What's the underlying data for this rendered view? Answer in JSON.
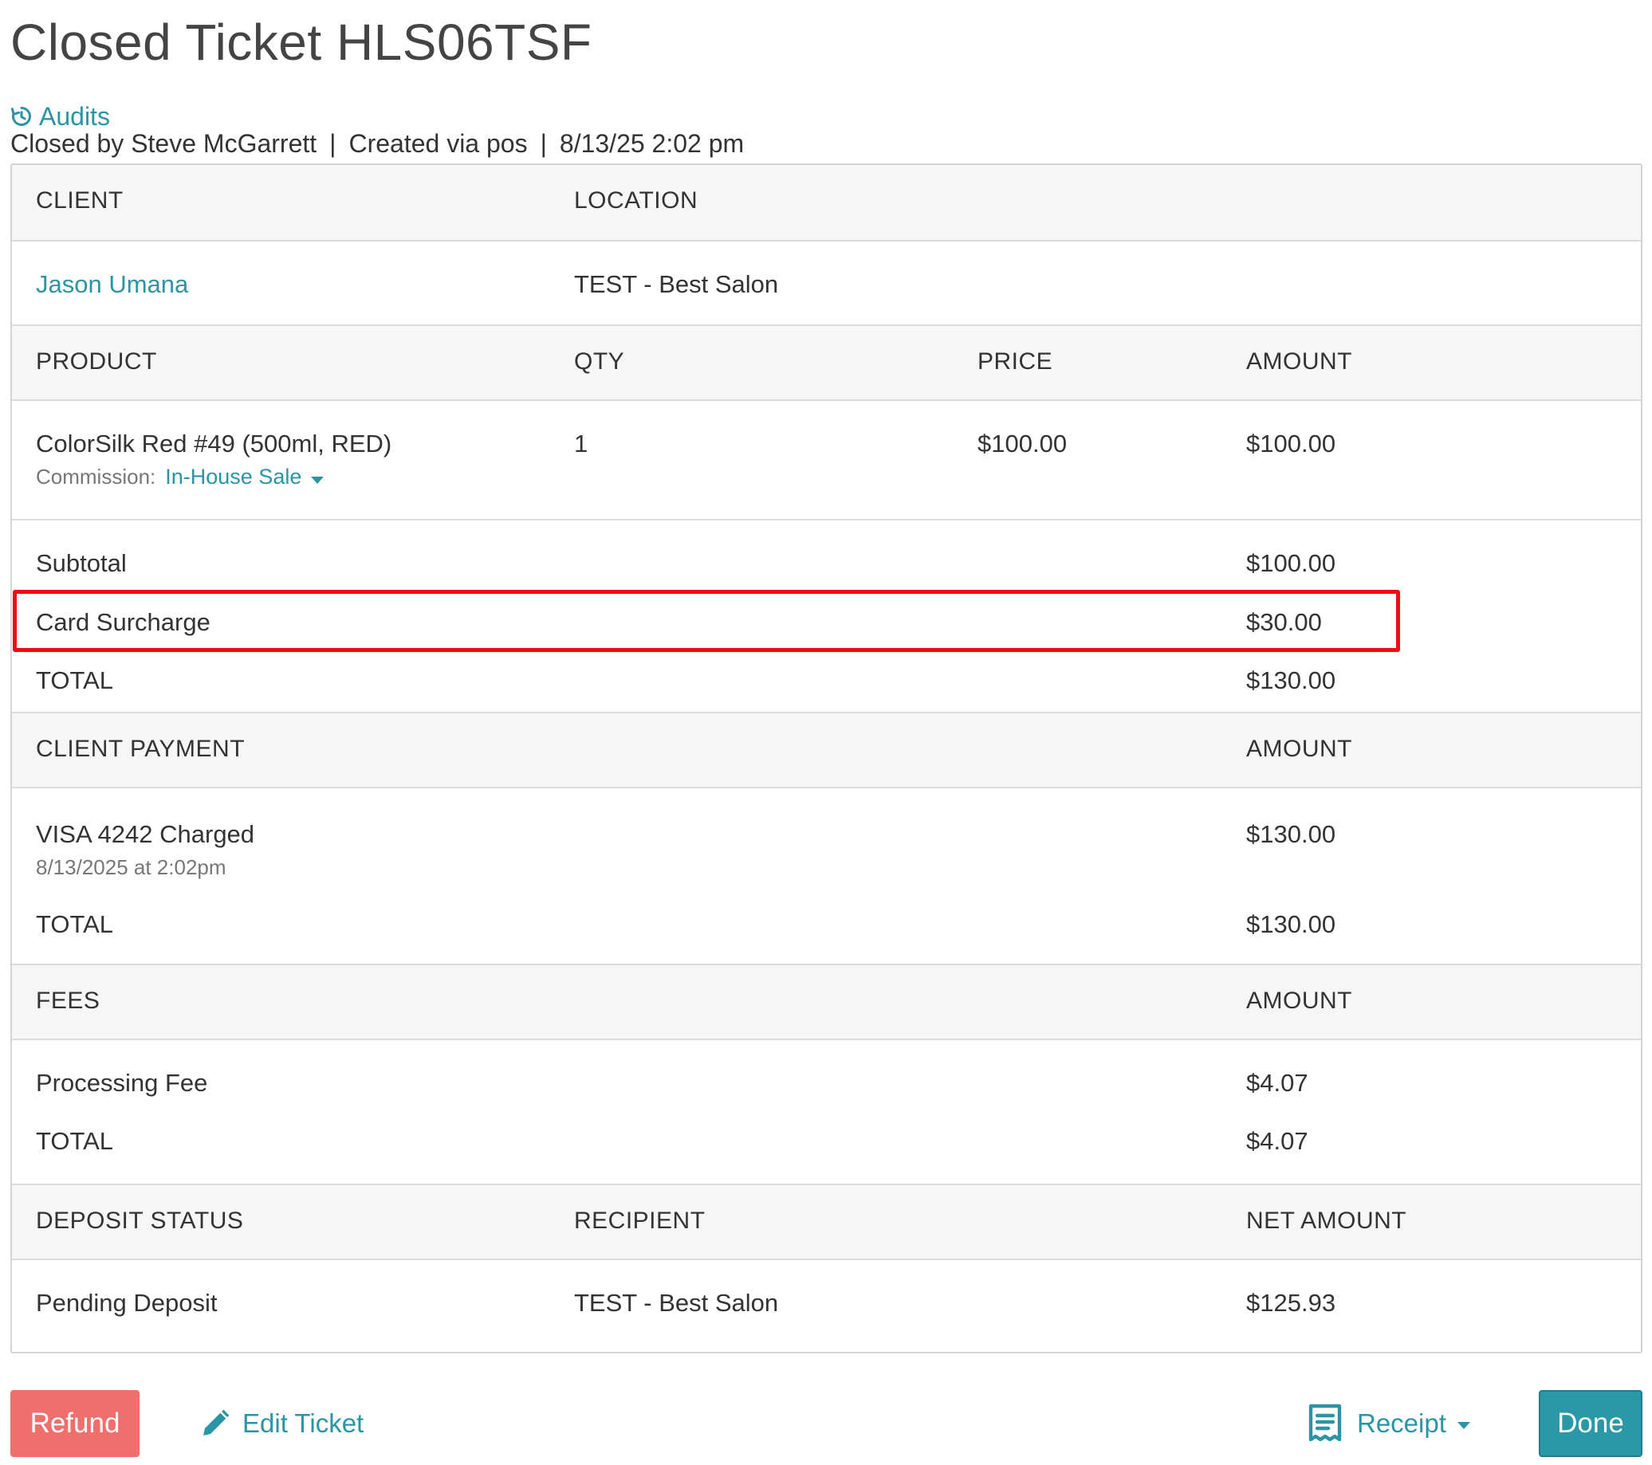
{
  "title": "Closed Ticket HLS06TSF",
  "audits_label": "Audits",
  "meta": {
    "closed_by": "Closed by Steve McGarrett",
    "created_via": "Created via pos",
    "datetime": "8/13/25 2:02 pm",
    "separator": "|"
  },
  "client_section": {
    "client_header": "CLIENT",
    "location_header": "LOCATION",
    "client_name": "Jason Umana",
    "location": "TEST - Best Salon"
  },
  "product_section": {
    "headers": {
      "product": "PRODUCT",
      "qty": "QTY",
      "price": "PRICE",
      "amount": "AMOUNT"
    },
    "items": [
      {
        "name": "ColorSilk Red #49 (500ml, RED)",
        "qty": "1",
        "price": "$100.00",
        "amount": "$100.00",
        "commission_label": "Commission:",
        "commission_value": "In-House Sale"
      }
    ]
  },
  "totals": {
    "subtotal_label": "Subtotal",
    "subtotal": "$100.00",
    "surcharge_label": "Card Surcharge",
    "surcharge": "$30.00",
    "total_label": "TOTAL",
    "total": "$130.00"
  },
  "payment_section": {
    "header": "CLIENT PAYMENT",
    "amount_header": "AMOUNT",
    "method": "VISA 4242 Charged",
    "date": "8/13/2025 at 2:02pm",
    "amount": "$130.00",
    "total_label": "TOTAL",
    "total": "$130.00"
  },
  "fees_section": {
    "header": "FEES",
    "amount_header": "AMOUNT",
    "fee_label": "Processing Fee",
    "fee": "$4.07",
    "total_label": "TOTAL",
    "total": "$4.07"
  },
  "deposit_section": {
    "status_header": "DEPOSIT STATUS",
    "recipient_header": "RECIPIENT",
    "net_header": "NET AMOUNT",
    "status": "Pending Deposit",
    "recipient": "TEST - Best Salon",
    "net_amount": "$125.93"
  },
  "actions": {
    "refund": "Refund",
    "edit": "Edit Ticket",
    "receipt": "Receipt",
    "done": "Done"
  },
  "colors": {
    "link": "#2b95a8",
    "refund_button": "#ef6f6c",
    "done_button": "#2b98a8",
    "highlight_border": "#ee0c12",
    "header_bg": "#f6f6f6"
  },
  "icons": {
    "audits": "history-icon",
    "edit": "pencil-icon",
    "receipt": "receipt-icon",
    "dropdown": "caret-down-icon"
  }
}
